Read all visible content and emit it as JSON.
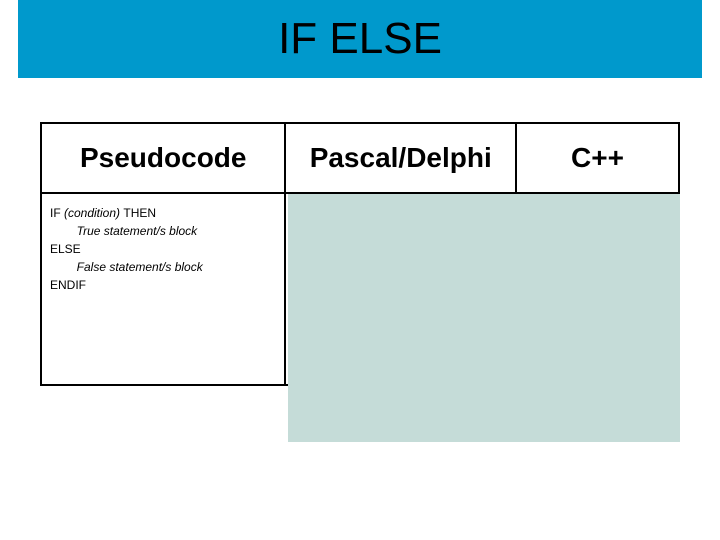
{
  "title": "IF ELSE",
  "headers": {
    "col1": "Pseudocode",
    "col2": "Pascal/Delphi",
    "col3": "C++"
  },
  "pseudocode": {
    "line1_kw": "IF ",
    "line1_cond": "(condition) ",
    "line1_then": "THEN",
    "line2": "        True statement/s block",
    "line3": "ELSE",
    "line4": "        False statement/s block",
    "line5": "ENDIF"
  }
}
